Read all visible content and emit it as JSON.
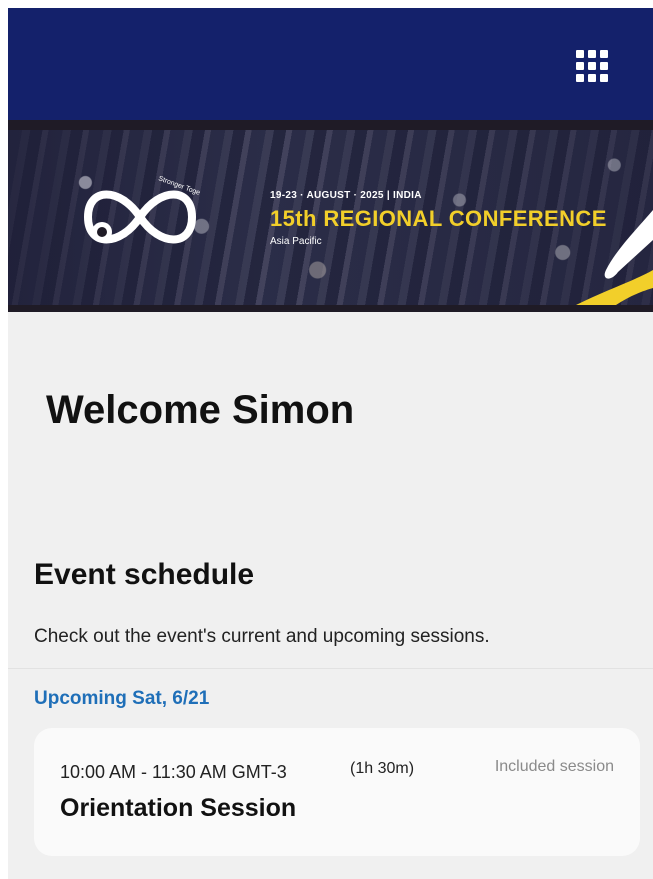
{
  "header": {
    "apps_icon": "grid-apps-icon",
    "bg_color": "#14216b"
  },
  "banner": {
    "dates": "19-23 · AUGUST · 2025 | INDIA",
    "title": "15th REGIONAL CONFERENCE",
    "subtitle": "Asia Pacific",
    "logo_text": "Stronger Together",
    "title_color": "#f2cf2a"
  },
  "welcome": {
    "text": "Welcome Simon"
  },
  "schedule": {
    "title": "Event schedule",
    "description": "Check out the event's current and upcoming sessions.",
    "day_label": "Upcoming Sat, 6/21",
    "accent_color": "#1f6fb8",
    "sessions": [
      {
        "time": "10:00 AM - 11:30 AM GMT-3",
        "duration": "(1h 30m)",
        "tag": "Included session",
        "name": "Orientation Session"
      }
    ]
  }
}
